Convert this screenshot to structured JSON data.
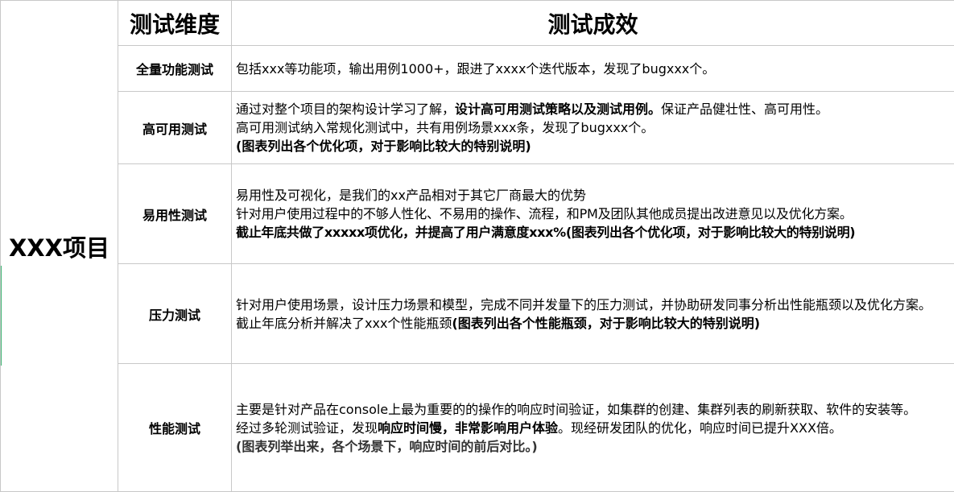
{
  "project": "XXX项目",
  "header": {
    "dimension": "测试维度",
    "result": "测试成效"
  },
  "colors": {
    "grid_line": "#c8c8c8",
    "left_accent": "#3cb371"
  },
  "rows": [
    {
      "dimension": "全量功能测试",
      "lines": [
        {
          "text": "包括xxx等功能项，输出用例1000+，跟进了xxxx个迭代版本，发现了bugxxx个。"
        }
      ]
    },
    {
      "dimension": "高可用测试",
      "lines": [
        {
          "pre": "通过对整个项目的架构设计学习了解，",
          "bold": "设计高可用测试策略以及测试用例。",
          "post": "保证产品健壮性、高可用性。"
        },
        {
          "text": "高可用测试纳入常规化测试中，共有用例场景xxx条，发现了bugxxx个。"
        },
        {
          "bold": "(图表列出各个优化项，对于影响比较大的特别说明)"
        }
      ]
    },
    {
      "dimension": "易用性测试",
      "lines": [
        {
          "text": "易用性及可视化，是我们的xx产品相对于其它厂商最大的优势"
        },
        {
          "text": "针对用户使用过程中的不够人性化、不易用的操作、流程，和PM及团队其他成员提出改进意见以及优化方案。"
        },
        {
          "bold": "截止年底共做了xxxxx项优化，并提高了用户满意度xxx%(图表列出各个优化项，对于影响比较大的特别说明)"
        }
      ]
    },
    {
      "dimension": "压力测试",
      "lines": [
        {
          "text": "针对用户使用场景，设计压力场景和模型，完成不同并发量下的压力测试，并协助研发同事分析出性能瓶颈以及优化方案。"
        },
        {
          "pre": "截止年底分析并解决了xxx个性能瓶颈",
          "bold": "(图表列出各个性能瓶颈，对于影响比较大的特别说明)"
        }
      ]
    },
    {
      "dimension": "性能测试",
      "lines": [
        {
          "text": "主要是针对产品在console上最为重要的的操作的响应时间验证，如集群的创建、集群列表的刷新获取、软件的安装等。"
        },
        {
          "pre": "经过多轮测试验证，发现",
          "bold": "响应时间慢，非常影响用户体验",
          "post": "。现经研发团队的优化，响应时间已提升XXX倍。"
        },
        {
          "bold": "(图表列举出来，各个场景下，响应时间的前后对比。)"
        }
      ]
    }
  ]
}
